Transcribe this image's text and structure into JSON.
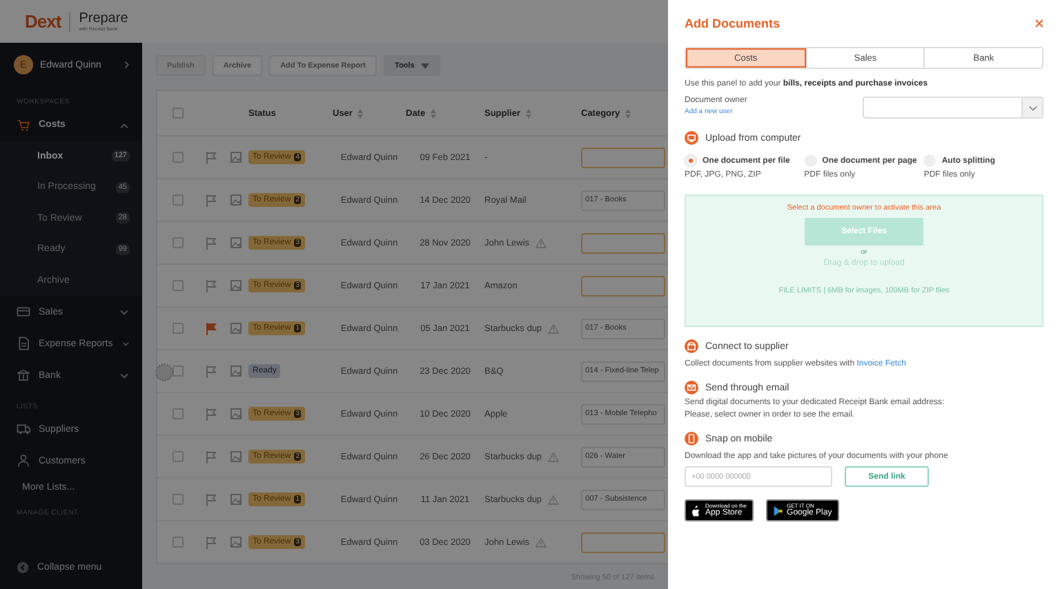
{
  "app_header": {
    "logo": "Dext",
    "product": "Prepare",
    "tagline": "with Receipt Bank"
  },
  "sidebar": {
    "user": {
      "initial": "E",
      "name": "Edward Quinn"
    },
    "sections": [
      {
        "title": "WORKSPACES",
        "items": [
          {
            "label": "Costs",
            "expanded": true,
            "children": [
              {
                "label": "Inbox",
                "count": "127",
                "selected": true
              },
              {
                "label": "In Processing",
                "count": "45",
                "selected": false
              },
              {
                "label": "To Review",
                "count": "28",
                "selected": false
              },
              {
                "label": "Ready",
                "count": "99",
                "selected": false
              },
              {
                "label": "Archive",
                "selected": false
              }
            ]
          },
          {
            "label": "Sales",
            "expanded": false
          },
          {
            "label": "Expense Reports",
            "expanded": false
          },
          {
            "label": "Bank",
            "expanded": false
          }
        ]
      },
      {
        "title": "LISTS",
        "items": [
          {
            "label": "Suppliers"
          },
          {
            "label": "Customers"
          },
          {
            "label": "More Lists..."
          }
        ]
      },
      {
        "title": "MANAGE CLIENT"
      }
    ],
    "collapse_label": "Collapse menu"
  },
  "toolbar": [
    {
      "label": "Publish",
      "kind": "button",
      "disabled": true
    },
    {
      "label": "Archive",
      "kind": "button",
      "disabled": false
    },
    {
      "label": "Add To Expense Report",
      "kind": "button",
      "disabled": false
    },
    {
      "label": "Tools",
      "kind": "menu",
      "disabled": false
    }
  ],
  "table": {
    "all_checked": false,
    "columns": [
      {
        "label": "Status",
        "sortable": false
      },
      {
        "label": "User",
        "sortable": true
      },
      {
        "label": "Date",
        "sortable": true
      },
      {
        "label": "Supplier",
        "sortable": true
      },
      {
        "label": "Category",
        "sortable": true
      }
    ],
    "rows": [
      {
        "checked": false,
        "flagged": false,
        "status": {
          "kind": "review",
          "label": "To Review",
          "count": "4"
        },
        "user": "Edward Quinn",
        "date": "09 Feb 2021",
        "supplier": "-",
        "warning": false
      },
      {
        "checked": false,
        "flagged": false,
        "status": {
          "kind": "review",
          "label": "To Review",
          "count": "2"
        },
        "user": "Edward Quinn",
        "date": "14 Dec 2020",
        "supplier": "Royal Mail",
        "warning": false,
        "category": "017 - Books"
      },
      {
        "checked": false,
        "flagged": false,
        "status": {
          "kind": "review",
          "label": "To Review",
          "count": "3"
        },
        "user": "Edward Quinn",
        "date": "28 Nov 2020",
        "supplier": "John Lewis",
        "warning": true
      },
      {
        "checked": false,
        "flagged": false,
        "status": {
          "kind": "review",
          "label": "To Review",
          "count": "3"
        },
        "user": "Edward Quinn",
        "date": "17 Jan 2021",
        "supplier": "Amazon",
        "warning": false
      },
      {
        "checked": false,
        "flagged": true,
        "status": {
          "kind": "review",
          "label": "To Review",
          "count": "1"
        },
        "user": "Edward Quinn",
        "date": "05 Jan 2021",
        "supplier": "Starbucks dup",
        "warning": true,
        "category": "017 - Books"
      },
      {
        "checked": false,
        "flagged": false,
        "status": {
          "kind": "ready",
          "label": "Ready"
        },
        "user": "Edward Quinn",
        "date": "23 Dec 2020",
        "supplier": "B&Q",
        "warning": false,
        "category": "014 - Fixed-line Telep"
      },
      {
        "checked": false,
        "flagged": false,
        "status": {
          "kind": "review",
          "label": "To Review",
          "count": "3"
        },
        "user": "Edward Quinn",
        "date": "10 Dec 2020",
        "supplier": "Apple",
        "warning": false,
        "category": "013 - Mobile Telepho"
      },
      {
        "checked": false,
        "flagged": false,
        "status": {
          "kind": "review",
          "label": "To Review",
          "count": "2"
        },
        "user": "Edward Quinn",
        "date": "26 Dec 2020",
        "supplier": "Starbucks dup",
        "warning": true,
        "category": "026 - Water"
      },
      {
        "checked": false,
        "flagged": false,
        "status": {
          "kind": "review",
          "label": "To Review",
          "count": "1"
        },
        "user": "Edward Quinn",
        "date": "11 Jan 2021",
        "supplier": "Starbucks dup",
        "warning": true,
        "category": "007 - Subsistence"
      },
      {
        "checked": false,
        "flagged": false,
        "status": {
          "kind": "review",
          "label": "To Review",
          "count": "3"
        },
        "user": "Edward Quinn",
        "date": "03 Dec 2020",
        "supplier": "John Lewis",
        "warning": true
      }
    ],
    "footer": "Showing 50 of 127 items"
  },
  "panel": {
    "title": "Add Documents",
    "tabs": [
      {
        "label": "Costs",
        "selected": true
      },
      {
        "label": "Sales",
        "selected": false
      },
      {
        "label": "Bank",
        "selected": false
      }
    ],
    "intro": "Use this panel to add your **bills, receipts and purchase invoices**",
    "owner": {
      "label": "Document owner",
      "link": "Add a new user"
    },
    "upload": {
      "title": "Upload from computer",
      "options": [
        {
          "label": "One document per file",
          "hint": "PDF, JPG, PNG, ZIP",
          "selected": true
        },
        {
          "label": "One document per page",
          "hint": "PDF files only",
          "selected": false
        },
        {
          "label": "Auto splitting",
          "hint": "PDF files only",
          "selected": false
        }
      ],
      "dropzone": {
        "warning": "Select a document owner to activate this area",
        "button": "Select Files",
        "or": "or",
        "drag": "Drag & drop to upload",
        "limits": "FILE LIMITS | 6MB for images, 100MB for ZIP files"
      }
    },
    "supplier": {
      "title": "Connect to supplier",
      "text": "Collect documents from supplier websites with",
      "link": "Invoice Fetch"
    },
    "email": {
      "title": "Send through email",
      "lines": [
        "Send digital documents to your dedicated Receipt Bank email address:",
        "Please, select owner in order to see the email."
      ]
    },
    "mobile": {
      "title": "Snap on mobile",
      "text": "Download the app and take pictures of your documents with your phone",
      "placeholder": "+00 0000 000000",
      "button": "Send link",
      "badges": [
        {
          "kind": "apple",
          "small": "Download on the",
          "big": "App Store"
        },
        {
          "kind": "google",
          "small": "GET IT ON",
          "big": "Google Play"
        }
      ]
    }
  }
}
